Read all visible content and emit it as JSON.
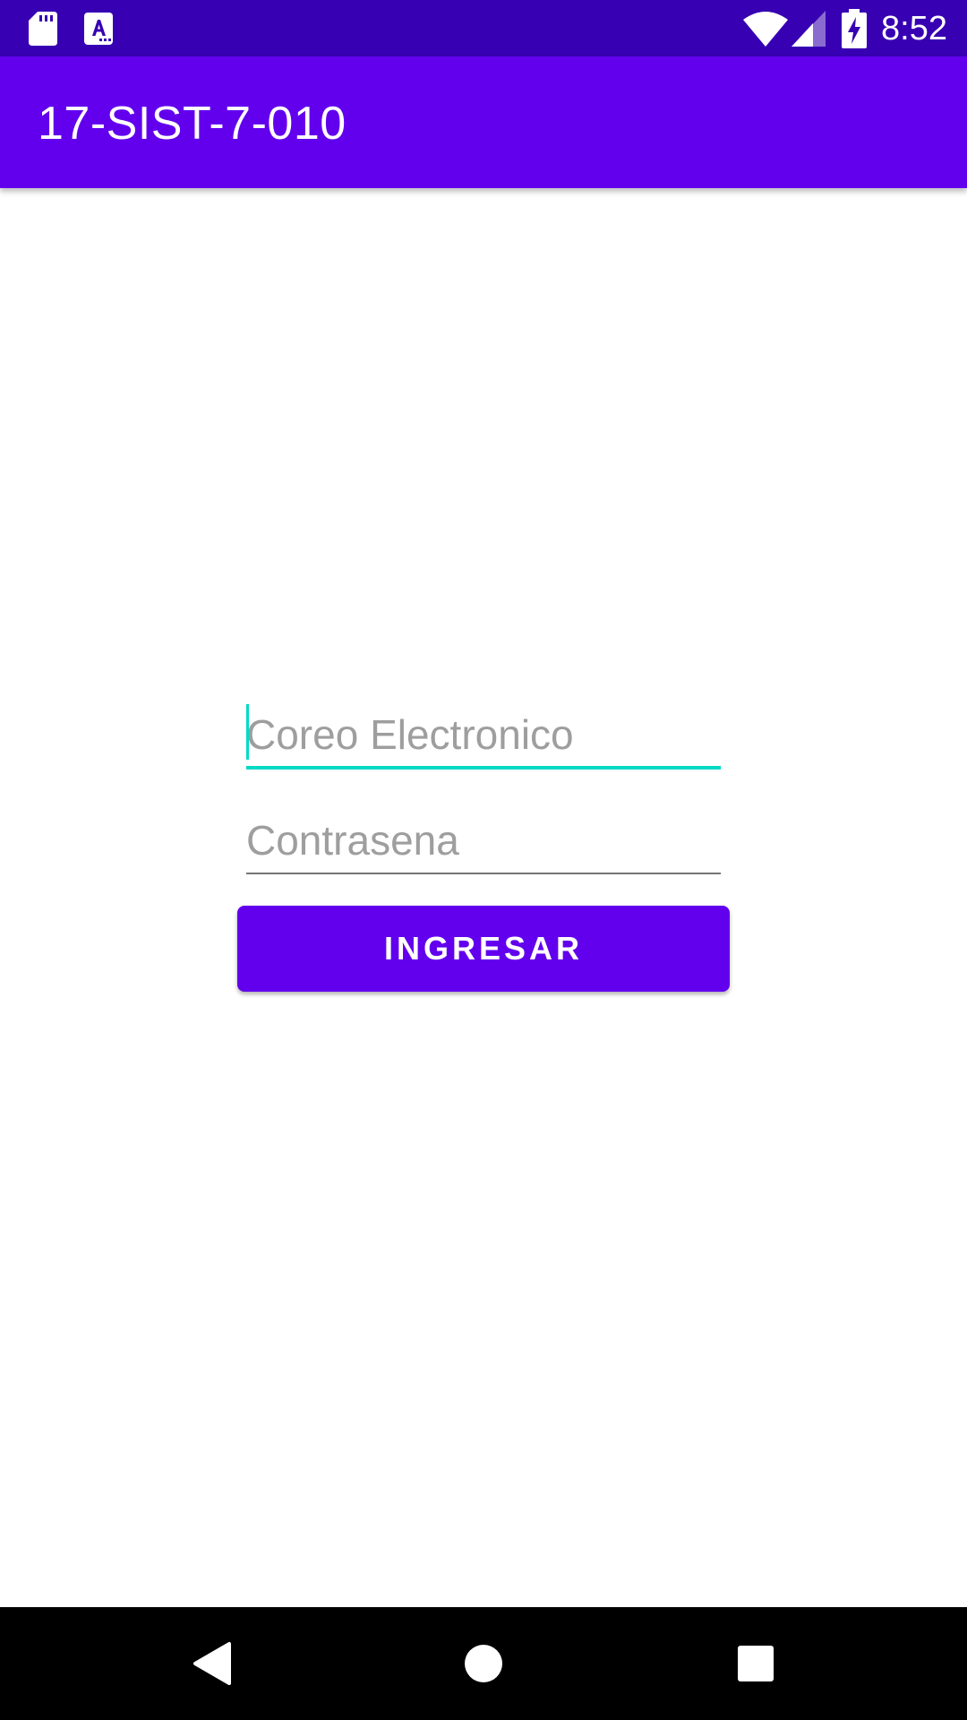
{
  "status_bar": {
    "time": "8:52",
    "icons": [
      "sd-card-icon",
      "a-accessibility-icon",
      "wifi-icon",
      "cell-signal-icon",
      "battery-charging-icon"
    ]
  },
  "app_bar": {
    "title": "17-SIST-7-010"
  },
  "form": {
    "email_placeholder": "Coreo Electronico",
    "email_value": "",
    "password_placeholder": "Contrasena",
    "password_value": "",
    "submit_label": "INGRESAR"
  },
  "nav_bar": {
    "icons": [
      "back-icon",
      "home-icon",
      "recents-icon"
    ]
  },
  "colors": {
    "status_bar": "#3700b3",
    "primary": "#6200ee",
    "accent": "#03dac5"
  }
}
